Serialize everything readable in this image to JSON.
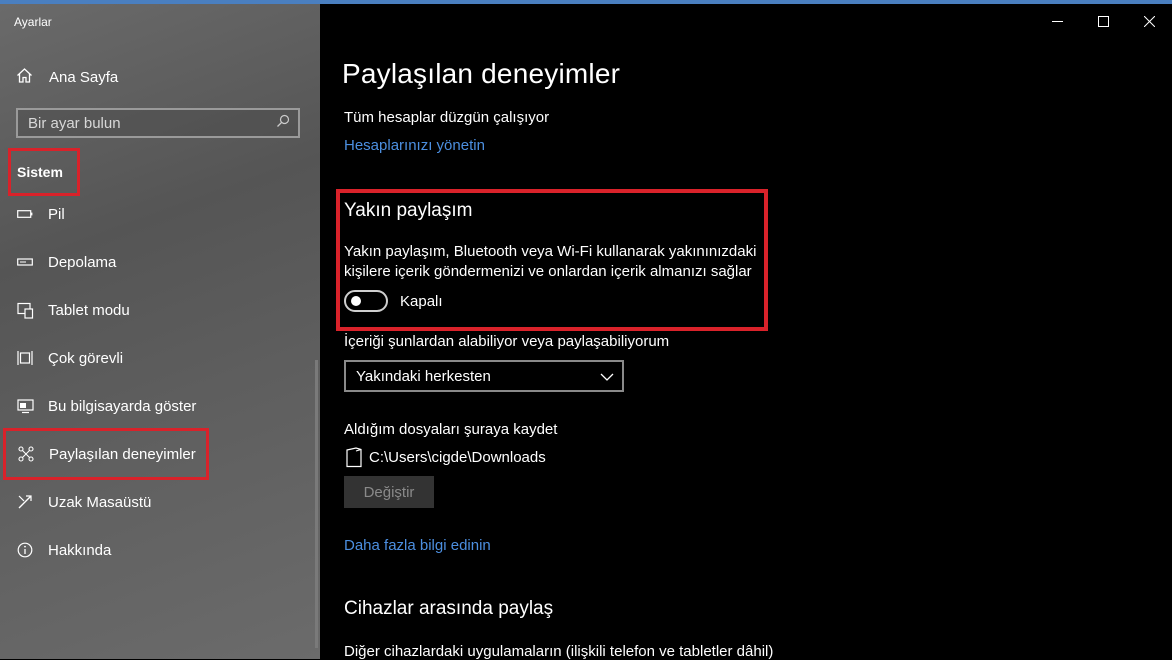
{
  "app": {
    "title": "Ayarlar"
  },
  "sidebar": {
    "home_label": "Ana Sayfa",
    "search_placeholder": "Bir ayar bulun",
    "section": "Sistem",
    "items": [
      {
        "label": "Pil",
        "icon": "battery-icon"
      },
      {
        "label": "Depolama",
        "icon": "storage-icon"
      },
      {
        "label": "Tablet modu",
        "icon": "tablet-mode-icon"
      },
      {
        "label": "Çok görevli",
        "icon": "multitasking-icon"
      },
      {
        "label": "Bu bilgisayarda göster",
        "icon": "project-icon"
      },
      {
        "label": "Paylaşılan deneyimler",
        "icon": "shared-experiences-icon",
        "selected": true
      },
      {
        "label": "Uzak Masaüstü",
        "icon": "remote-desktop-icon"
      },
      {
        "label": "Hakkında",
        "icon": "info-icon"
      }
    ]
  },
  "main": {
    "title": "Paylaşılan deneyimler",
    "accounts_status": "Tüm hesaplar düzgün çalışıyor",
    "manage_accounts_link": "Hesaplarınızı yönetin",
    "nearby": {
      "heading": "Yakın paylaşım",
      "description": "Yakın paylaşım, Bluetooth veya Wi-Fi kullanarak yakınınızdaki kişilere içerik göndermenizi ve onlardan içerik almanızı sağlar",
      "toggle_label": "Kapalı",
      "toggle_on": false
    },
    "share_from_label": "İçeriği şunlardan alabiliyor veya paylaşabiliyorum",
    "share_from_value": "Yakındaki herkesten",
    "save_files_label": "Aldığım dosyaları şuraya kaydet",
    "save_path": "C:\\Users\\cigde\\Downloads",
    "change_button": "Değiştir",
    "learn_more_link": "Daha fazla bilgi edinin",
    "cross_device_heading": "Cihazlar arasında paylaş",
    "cross_device_desc": "Diğer cihazlardaki uygulamaların (ilişkili telefon ve tabletler dâhil)"
  },
  "colors": {
    "highlight_border": "#d9222a",
    "link": "#4c8fe0",
    "background": "#000000"
  }
}
